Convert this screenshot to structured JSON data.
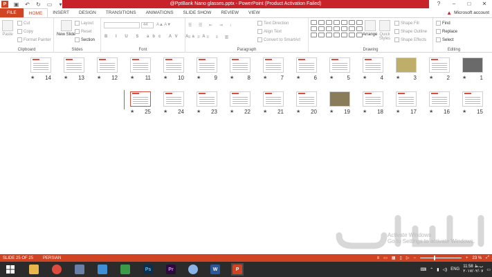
{
  "window": {
    "title": "@PptBank Nano glasses.pptx - PowerPoint (Product Activation Failed)",
    "account_label": "Microsoft account",
    "controls": [
      "?",
      "–",
      "□",
      "✕"
    ]
  },
  "tabs": [
    {
      "label": "FILE",
      "kind": "file"
    },
    {
      "label": "HOME",
      "kind": "active"
    },
    {
      "label": "INSERT",
      "kind": ""
    },
    {
      "label": "DESIGN",
      "kind": ""
    },
    {
      "label": "TRANSITIONS",
      "kind": ""
    },
    {
      "label": "ANIMATIONS",
      "kind": ""
    },
    {
      "label": "SLIDE SHOW",
      "kind": ""
    },
    {
      "label": "REVIEW",
      "kind": ""
    },
    {
      "label": "VIEW",
      "kind": ""
    }
  ],
  "ribbon": {
    "clipboard": {
      "label": "Clipboard",
      "paste": "Paste",
      "cut": "Cut",
      "copy": "Copy",
      "format_painter": "Format Painter"
    },
    "slides": {
      "label": "Slides",
      "new_slide": "New Slide",
      "layout": "Layout",
      "reset": "Reset",
      "section": "Section"
    },
    "font": {
      "label": "Font",
      "size": "44"
    },
    "paragraph": {
      "label": "Paragraph",
      "text_direction": "Text Direction",
      "align_text": "Align Text",
      "smartart": "Convert to SmartArt"
    },
    "drawing": {
      "label": "Drawing",
      "arrange": "Arrange",
      "quick_styles": "Quick Styles",
      "shape_fill": "Shape Fill",
      "shape_outline": "Shape Outline",
      "shape_effects": "Shape Effects"
    },
    "editing": {
      "label": "Editing",
      "find": "Find",
      "replace": "Replace",
      "select": "Select"
    }
  },
  "slides_row1": [
    14,
    13,
    12,
    11,
    10,
    9,
    8,
    7,
    6,
    5,
    4,
    3,
    2,
    1
  ],
  "slides_row2": [
    25,
    24,
    23,
    22,
    21,
    20,
    19,
    18,
    17,
    16,
    15
  ],
  "watermark": {
    "activate_line1": "Activate Windows",
    "activate_line2": "Go to Settings to activate Windows."
  },
  "status": {
    "slide": "SLIDE 25 OF 25",
    "language": "PERSIAN",
    "zoom": "23 %"
  },
  "tray": {
    "lang": "ENG",
    "time": "11:58 ب.ظ",
    "date": "۲۰۱۷/۰۲/۰۷"
  },
  "colors": {
    "accent": "#d04423",
    "title_bar": "#c8222b",
    "taskbar": "#2b2b2b"
  }
}
